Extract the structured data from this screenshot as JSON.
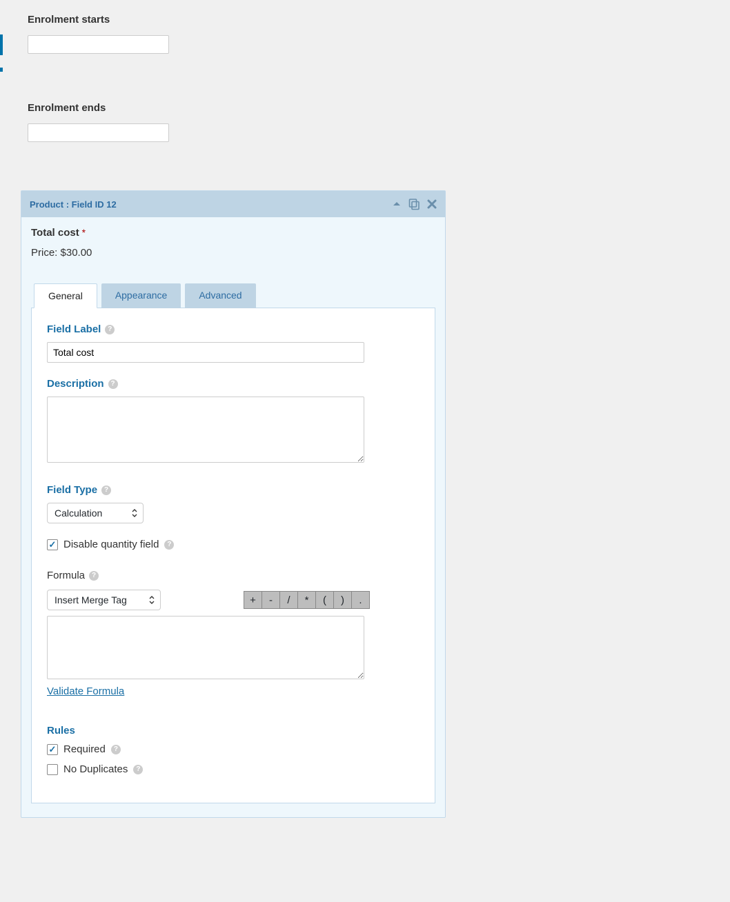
{
  "outer": {
    "enrolment_starts_label": "Enrolment starts",
    "enrolment_starts_value": "",
    "enrolment_ends_label": "Enrolment ends",
    "enrolment_ends_value": ""
  },
  "editor": {
    "header_title": "Product : Field ID 12",
    "field_name": "Total cost",
    "required_marker": "*",
    "price_label": "Price:",
    "price_value": "$30.00",
    "tabs": {
      "general": "General",
      "appearance": "Appearance",
      "advanced": "Advanced"
    },
    "general": {
      "field_label_heading": "Field Label",
      "field_label_value": "Total cost",
      "description_heading": "Description",
      "description_value": "",
      "field_type_heading": "Field Type",
      "field_type_value": "Calculation",
      "disable_qty_label": "Disable quantity field",
      "disable_qty_checked": true,
      "formula_heading": "Formula",
      "merge_tag_select": "Insert Merge Tag",
      "ops": [
        "+",
        "-",
        "/",
        "*",
        "(",
        ")",
        "."
      ],
      "formula_value": "",
      "validate_link": "Validate Formula",
      "rules_heading": "Rules",
      "required_label": "Required",
      "required_checked": true,
      "no_duplicates_label": "No Duplicates",
      "no_duplicates_checked": false
    }
  }
}
